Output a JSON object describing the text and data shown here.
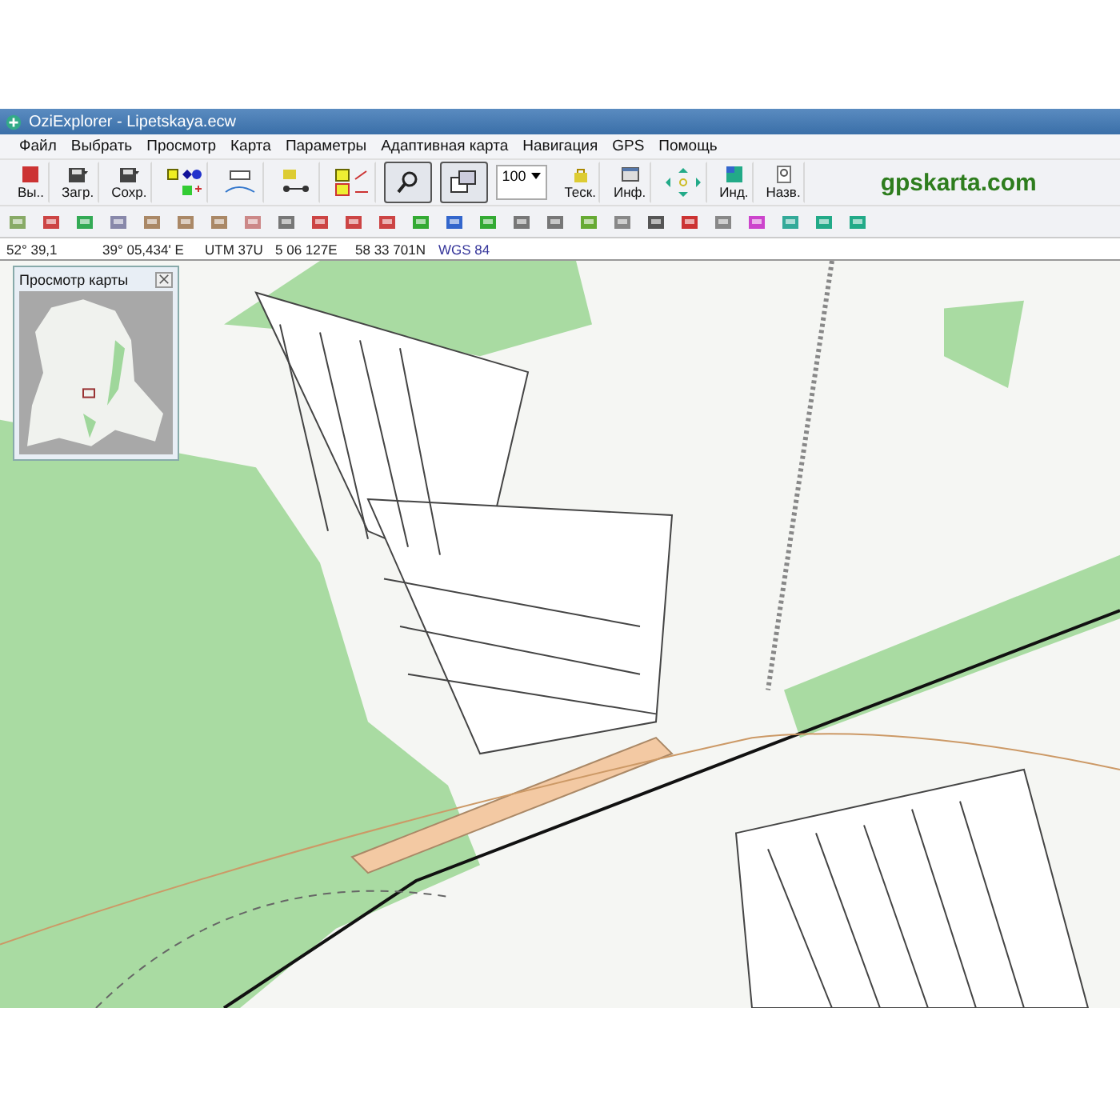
{
  "window": {
    "title": "OziExplorer - Lipetskaya.ecw"
  },
  "menu": [
    "Файл",
    "Выбрать",
    "Просмотр",
    "Карта",
    "Параметры",
    "Адаптивная карта",
    "Навигация",
    "GPS",
    "Помощь"
  ],
  "toolbar": [
    {
      "kind": "exit",
      "label": "Вы..",
      "selected": false
    },
    {
      "kind": "load",
      "label": "Загр.",
      "selected": false
    },
    {
      "kind": "save",
      "label": "Сохр.",
      "selected": false
    },
    {
      "kind": "points",
      "selected": false
    },
    {
      "kind": "tracks",
      "selected": false
    },
    {
      "kind": "route",
      "selected": false
    },
    {
      "kind": "layers",
      "selected": false
    },
    {
      "kind": "magnifier",
      "selected": true
    },
    {
      "kind": "window",
      "selected": true
    },
    {
      "kind": "zoom",
      "value": "100"
    },
    {
      "kind": "lock",
      "label": "Теск.",
      "selected": false
    },
    {
      "kind": "info",
      "label": "Инф.",
      "selected": false
    },
    {
      "kind": "arrows",
      "selected": false
    },
    {
      "kind": "index",
      "label": "Инд.",
      "selected": false
    },
    {
      "kind": "names",
      "label": "Назв.",
      "selected": false
    }
  ],
  "brand": "gpskarta.com",
  "coords": [
    "52° 39,1",
    "39° 05,434' E",
    "UTM 37U",
    "5 06 127E",
    "58 33 701N",
    "WGS 84"
  ],
  "overview": {
    "title": "Просмотр карты"
  }
}
